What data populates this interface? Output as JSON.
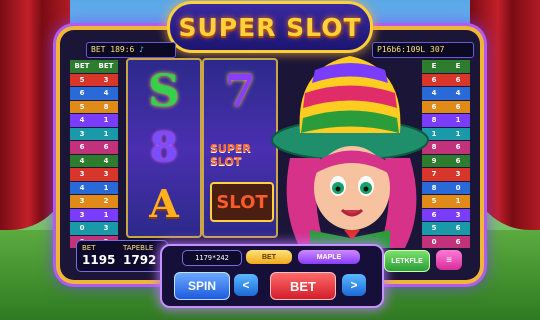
{
  "title": "SUPER SLOT",
  "info_left": {
    "bet_label": "BET",
    "value": "189:6",
    "icon": "sound-icon"
  },
  "info_right": {
    "value": "P16b6:109L",
    "count": "307"
  },
  "paytable_left": [
    [
      "BET",
      "BET"
    ],
    [
      "5",
      "3"
    ],
    [
      "6",
      "4"
    ],
    [
      "5",
      "8"
    ],
    [
      "4",
      "1"
    ],
    [
      "3",
      "1"
    ],
    [
      "6",
      "6"
    ],
    [
      "4",
      "4"
    ],
    [
      "3",
      "3"
    ],
    [
      "4",
      "1"
    ],
    [
      "3",
      "2"
    ],
    [
      "3",
      "1"
    ],
    [
      "0",
      "3"
    ],
    [
      "0",
      "3"
    ]
  ],
  "paytable_right": [
    [
      "E",
      "E"
    ],
    [
      "6",
      "6"
    ],
    [
      "4",
      "4"
    ],
    [
      "6",
      "6"
    ],
    [
      "8",
      "1"
    ],
    [
      "1",
      "1"
    ],
    [
      "8",
      "6"
    ],
    [
      "9",
      "6"
    ],
    [
      "7",
      "3"
    ],
    [
      "8",
      "0"
    ],
    [
      "5",
      "1"
    ],
    [
      "6",
      "3"
    ],
    [
      "5",
      "6"
    ],
    [
      "0",
      "6"
    ]
  ],
  "reels": [
    [
      "S",
      "8",
      "A"
    ],
    [
      "7",
      "SUPER SLOT",
      "SLOT"
    ]
  ],
  "status": {
    "bet_label": "BET",
    "bet_value": "1195",
    "table_label": "TAPEBLE",
    "table_value": "1792"
  },
  "controls": {
    "display": "1179*242",
    "bet_small": "BET",
    "maple": "MAPLE",
    "spin": "SPIN",
    "bet": "BET",
    "prev_arrow": "<",
    "next_arrow": ">",
    "extra": "LETKFLE"
  },
  "colors": {
    "frame": "#f2b635",
    "glow": "#b25bf0",
    "title": "#ffd13b"
  }
}
